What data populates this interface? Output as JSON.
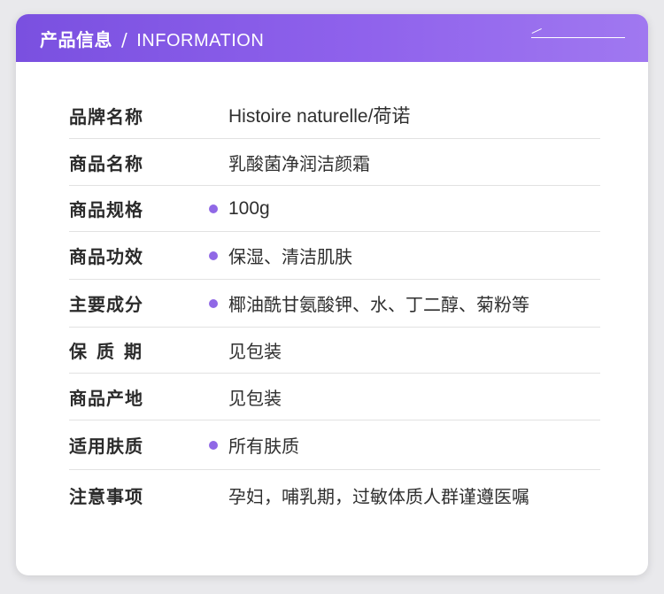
{
  "header": {
    "title_cn": "产品信息",
    "separator": "/",
    "title_en": "INFORMATION"
  },
  "accent_color": "#8a5ce8",
  "bullet_color": "#9068e6",
  "rows": [
    {
      "label": "品牌名称",
      "value": "Histoire naturelle/荷诺",
      "bullet": false
    },
    {
      "label": "商品名称",
      "value": "乳酸菌净润洁颜霜",
      "bullet": false
    },
    {
      "label": "商品规格",
      "value": "100g",
      "bullet": true
    },
    {
      "label": "商品功效",
      "value": "保湿、清洁肌肤",
      "bullet": true
    },
    {
      "label": "主要成分",
      "value": "椰油酰甘氨酸钾、水、丁二醇、菊粉等",
      "bullet": true
    },
    {
      "label": "保质期",
      "value": "见包装",
      "bullet": false
    },
    {
      "label": "商品产地",
      "value": "见包装",
      "bullet": false
    },
    {
      "label": "适用肤质",
      "value": "所有肤质",
      "bullet": true
    },
    {
      "label": "注意事项",
      "value": "孕妇，哺乳期，过敏体质人群谨遵医嘱",
      "bullet": false
    }
  ]
}
